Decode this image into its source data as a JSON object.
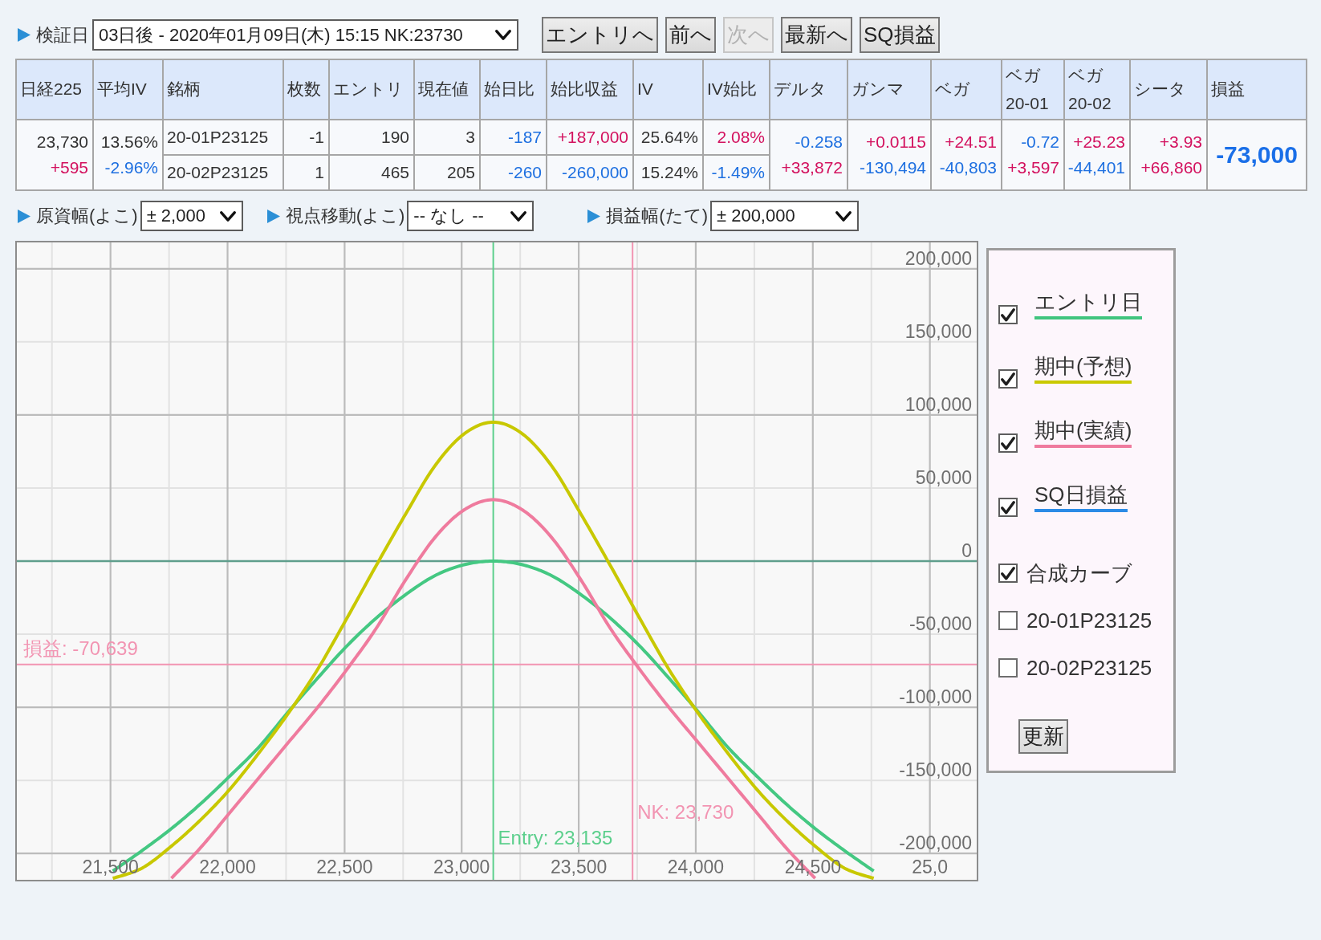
{
  "toolbar": {
    "label": "検証日",
    "date_select": {
      "value": "03日後 - 2020年01月09日(木) 15:15 NK:23730"
    },
    "buttons": [
      {
        "label": "エントリへ",
        "disabled": false
      },
      {
        "label": "前へ",
        "disabled": false
      },
      {
        "label": "次へ",
        "disabled": true
      },
      {
        "label": "最新へ",
        "disabled": false
      },
      {
        "label": "SQ損益",
        "disabled": false
      }
    ]
  },
  "table": {
    "columns": [
      {
        "label": "日経225"
      },
      {
        "label": "平均IV"
      },
      {
        "label": "銘柄"
      },
      {
        "label": "枚数"
      },
      {
        "label": "エントリ"
      },
      {
        "label": "現在値"
      },
      {
        "label": "始日比"
      },
      {
        "label": "始比収益"
      },
      {
        "label": "IV"
      },
      {
        "label": "IV始比"
      },
      {
        "label": "デルタ"
      },
      {
        "label": "ガンマ"
      },
      {
        "label": "ベガ"
      },
      {
        "label": "ベガ",
        "sub": "20-01"
      },
      {
        "label": "ベガ",
        "sub": "20-02"
      },
      {
        "label": "シータ"
      },
      {
        "label": "損益"
      }
    ],
    "nikkei": [
      {
        "text": "23,730"
      },
      {
        "text": "+595",
        "color": "#d3115e"
      }
    ],
    "avg_iv": [
      {
        "text": "13.56%"
      },
      {
        "text": "-2.96%",
        "color": "#1d6fe0"
      }
    ],
    "rows": [
      {
        "symbol": "20-01P23125",
        "qty": "-1",
        "entry": "190",
        "current": "3",
        "day_change": {
          "text": "-187",
          "color": "#1d6fe0"
        },
        "pnl_change": {
          "text": "+187,000",
          "color": "#d3115e"
        },
        "iv": "25.64%",
        "iv_change": {
          "text": "2.08%",
          "color": "#d3115e"
        }
      },
      {
        "symbol": "20-02P23125",
        "qty": "1",
        "entry": "465",
        "current": "205",
        "day_change": {
          "text": "-260",
          "color": "#1d6fe0"
        },
        "pnl_change": {
          "text": "-260,000",
          "color": "#1d6fe0"
        },
        "iv": "15.24%",
        "iv_change": {
          "text": "-1.49%",
          "color": "#1d6fe0"
        }
      }
    ],
    "greeks": [
      [
        {
          "text": "-0.258",
          "color": "#1d6fe0"
        },
        {
          "text": "+33,872",
          "color": "#d3115e"
        }
      ],
      [
        {
          "text": "+0.0115",
          "color": "#d3115e"
        },
        {
          "text": "-130,494",
          "color": "#1d6fe0"
        }
      ],
      [
        {
          "text": "+24.51",
          "color": "#d3115e"
        },
        {
          "text": "-40,803",
          "color": "#1d6fe0"
        }
      ],
      [
        {
          "text": "-0.72",
          "color": "#1d6fe0"
        },
        {
          "text": "+3,597",
          "color": "#d3115e"
        }
      ],
      [
        {
          "text": "+25.23",
          "color": "#d3115e"
        },
        {
          "text": "-44,401",
          "color": "#1d6fe0"
        }
      ],
      [
        {
          "text": "+3.93",
          "color": "#d3115e"
        },
        {
          "text": "+66,860",
          "color": "#d3115e"
        }
      ]
    ],
    "pnl": {
      "text": "-73,000",
      "color": "#1a6fe8"
    }
  },
  "view_controls": [
    {
      "label": "原資幅(よこ)",
      "value": "± 2,000"
    },
    {
      "label": "視点移動(よこ)",
      "value": "-- なし --"
    },
    {
      "label": "損益幅(たて)",
      "value": "± 200,000"
    }
  ],
  "chart": {
    "edge_tick_label": "25,0",
    "chart_data": {
      "type": "line",
      "grid": true,
      "x": [
        21510,
        21635,
        21760,
        21885,
        22010,
        22135,
        22260,
        22385,
        22510,
        22635,
        22760,
        22885,
        23010,
        23135,
        23260,
        23385,
        23510,
        23635,
        23760,
        23885,
        24010,
        24135,
        24260,
        24385,
        24510,
        24635,
        24760
      ],
      "series": [
        {
          "color": "#44c882",
          "values": [
            -212000,
            -198000,
            -183000,
            -166000,
            -147000,
            -127000,
            -103000,
            -80000,
            -58000,
            -39000,
            -23000,
            -10000,
            -2500,
            0,
            -2500,
            -10000,
            -23000,
            -39000,
            -58000,
            -80000,
            -103000,
            -127000,
            -147000,
            -166000,
            -183000,
            -198000,
            -212000
          ]
        },
        {
          "color": "#c8c800",
          "values": [
            -217000,
            -210000,
            -195000,
            -177000,
            -156000,
            -131000,
            -104000,
            -74000,
            -39000,
            -3000,
            32000,
            65000,
            87000,
            95000,
            87000,
            65000,
            32000,
            -3000,
            -39000,
            -74000,
            -104000,
            -131000,
            -156000,
            -177000,
            -195000,
            -210000,
            -217000
          ]
        },
        {
          "color": "#ef7b9e",
          "values": [
            null,
            null,
            -217000,
            -196000,
            -172000,
            -148000,
            -124000,
            -100000,
            -74000,
            -46000,
            -13000,
            16000,
            35000,
            42000,
            35000,
            16000,
            -13000,
            -46000,
            -74000,
            -100000,
            -124000,
            -148000,
            -172000,
            -196000,
            -217000,
            null,
            null
          ]
        }
      ],
      "xlim": [
        21100,
        25200
      ],
      "ylim": [
        -218000,
        218000
      ],
      "xticks": [
        {
          "value": 21500,
          "label": "21,500"
        },
        {
          "value": 22000,
          "label": "22,000"
        },
        {
          "value": 22500,
          "label": "22,500"
        },
        {
          "value": 23000,
          "label": "23,000"
        },
        {
          "value": 23500,
          "label": "23,500"
        },
        {
          "value": 24000,
          "label": "24,000"
        },
        {
          "value": 24500,
          "label": "24,500"
        }
      ],
      "yticks": [
        {
          "value": 200000,
          "label": "200,000"
        },
        {
          "value": 150000,
          "label": "150,000"
        },
        {
          "value": 100000,
          "label": "100,000"
        },
        {
          "value": 50000,
          "label": "50,000"
        },
        {
          "value": 0,
          "label": "0"
        },
        {
          "value": -50000,
          "label": "-50,000"
        },
        {
          "value": -100000,
          "label": "-100,000"
        },
        {
          "value": -150000,
          "label": "-150,000"
        },
        {
          "value": -200000,
          "label": "-200,000"
        }
      ],
      "ref_lines": [
        {
          "axis": "y",
          "value": 0,
          "color": "#5f9e8d"
        },
        {
          "axis": "y",
          "value": -70639,
          "label": "損益: -70,639",
          "color": "#f294b2"
        },
        {
          "axis": "x",
          "value": 23730,
          "label": "NK: 23,730",
          "color": "#f294b2"
        },
        {
          "axis": "x",
          "value": 23135,
          "label": "Entry: 23,135",
          "color": "#5ccf8c"
        }
      ]
    }
  },
  "legend": {
    "items": [
      {
        "kind": "series",
        "label": "エントリ日",
        "checked": true,
        "color": "#40c47e"
      },
      {
        "kind": "series",
        "label": "期中(予想)",
        "checked": true,
        "color": "#c9c900"
      },
      {
        "kind": "series",
        "label": "期中(実績)",
        "checked": true,
        "color": "#ef7b9e"
      },
      {
        "kind": "series",
        "label": "SQ日損益",
        "checked": true,
        "color": "#2b8be6"
      },
      {
        "kind": "toggle",
        "label": "合成カーブ",
        "checked": true
      },
      {
        "kind": "toggle",
        "label": "20-01P23125",
        "checked": false
      },
      {
        "kind": "toggle",
        "label": "20-02P23125",
        "checked": false
      }
    ],
    "button": "更新"
  }
}
